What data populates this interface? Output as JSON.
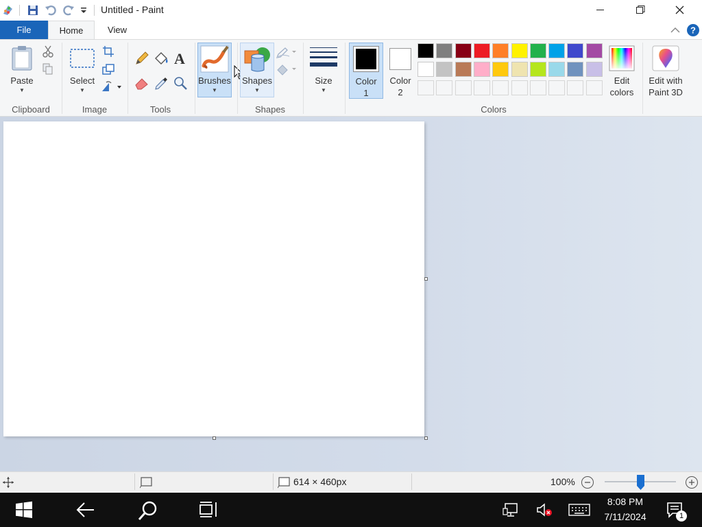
{
  "window": {
    "title": "Untitled - Paint"
  },
  "tabs": {
    "file": "File",
    "home": "Home",
    "view": "View"
  },
  "ribbon": {
    "clipboard": {
      "paste": "Paste",
      "group": "Clipboard"
    },
    "image": {
      "select": "Select",
      "group": "Image"
    },
    "tools": {
      "group": "Tools"
    },
    "brushes": {
      "label": "Brushes"
    },
    "shapes": {
      "label": "Shapes",
      "group": "Shapes"
    },
    "size": {
      "label": "Size"
    },
    "color1": {
      "line1": "Color",
      "line2": "1"
    },
    "color2": {
      "line1": "Color",
      "line2": "2"
    },
    "colors": {
      "group": "Colors",
      "palette_row1": [
        "#000000",
        "#7f7f7f",
        "#880015",
        "#ed1c24",
        "#ff7f27",
        "#fff200",
        "#22b14c",
        "#00a2e8",
        "#3f48cc",
        "#a349a4"
      ],
      "palette_row2": [
        "#ffffff",
        "#c3c3c3",
        "#b97a57",
        "#ffaec9",
        "#ffc90e",
        "#efe4b0",
        "#b5e61d",
        "#99d9ea",
        "#7092be",
        "#c8bfe7"
      ]
    },
    "edit_colors": {
      "line1": "Edit",
      "line2": "colors"
    },
    "paint3d": {
      "line1": "Edit with",
      "line2": "Paint 3D"
    }
  },
  "status": {
    "canvas_size": "614 × 460px",
    "zoom": "100%",
    "zoom_level_fraction": 0.5
  },
  "taskbar": {
    "time": "8:08 PM",
    "date": "7/11/2024",
    "notifications": "1"
  }
}
